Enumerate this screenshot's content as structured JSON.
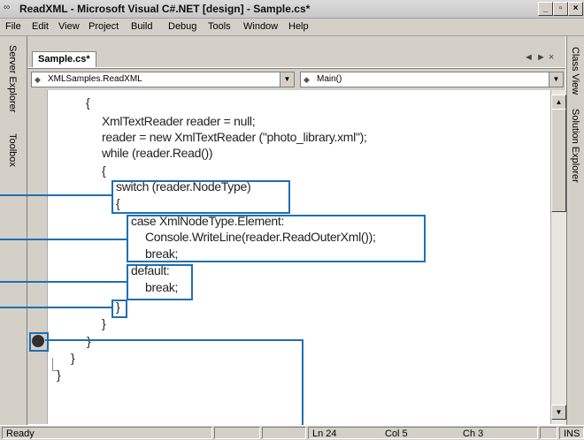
{
  "window": {
    "icon": "vs-icon",
    "title": "ReadXML - Microsoft Visual C#.NET [design] - Sample.cs*",
    "controls": [
      "_",
      "×"
    ]
  },
  "menu": [
    "File",
    "Edit",
    "View",
    "Project",
    "Build",
    "Debug",
    "Tools",
    "Window",
    "Help"
  ],
  "left_panels": [
    "Server Explorer",
    "Toolbox"
  ],
  "right_panels": [
    "Class View",
    "Solution Explorer"
  ],
  "document_tab": "Sample.cs*",
  "tab_nav": "◄ ► ×",
  "combos": {
    "class": "XMLSamples.ReadXML",
    "member": "Main()"
  },
  "code_lines": [
    "{",
    "XmlTextReader reader = null;",
    "reader = new XmlTextReader (\"photo_library.xml\");",
    "while (reader.Read())",
    "{",
    "switch (reader.NodeType)",
    "{",
    "case XmlNodeType.Element:",
    "Console.WriteLine(reader.ReadOuterXml());",
    "break;",
    "default:",
    "break;",
    "}",
    "}",
    "}",
    "}",
    "}"
  ],
  "status": {
    "message": "Ready",
    "line": "Ln 24",
    "col": "Col 5",
    "ch": "Ch 3",
    "mode": "INS"
  },
  "colors": {
    "callout": "#1e6fb4",
    "breakpoint": "#303030"
  }
}
